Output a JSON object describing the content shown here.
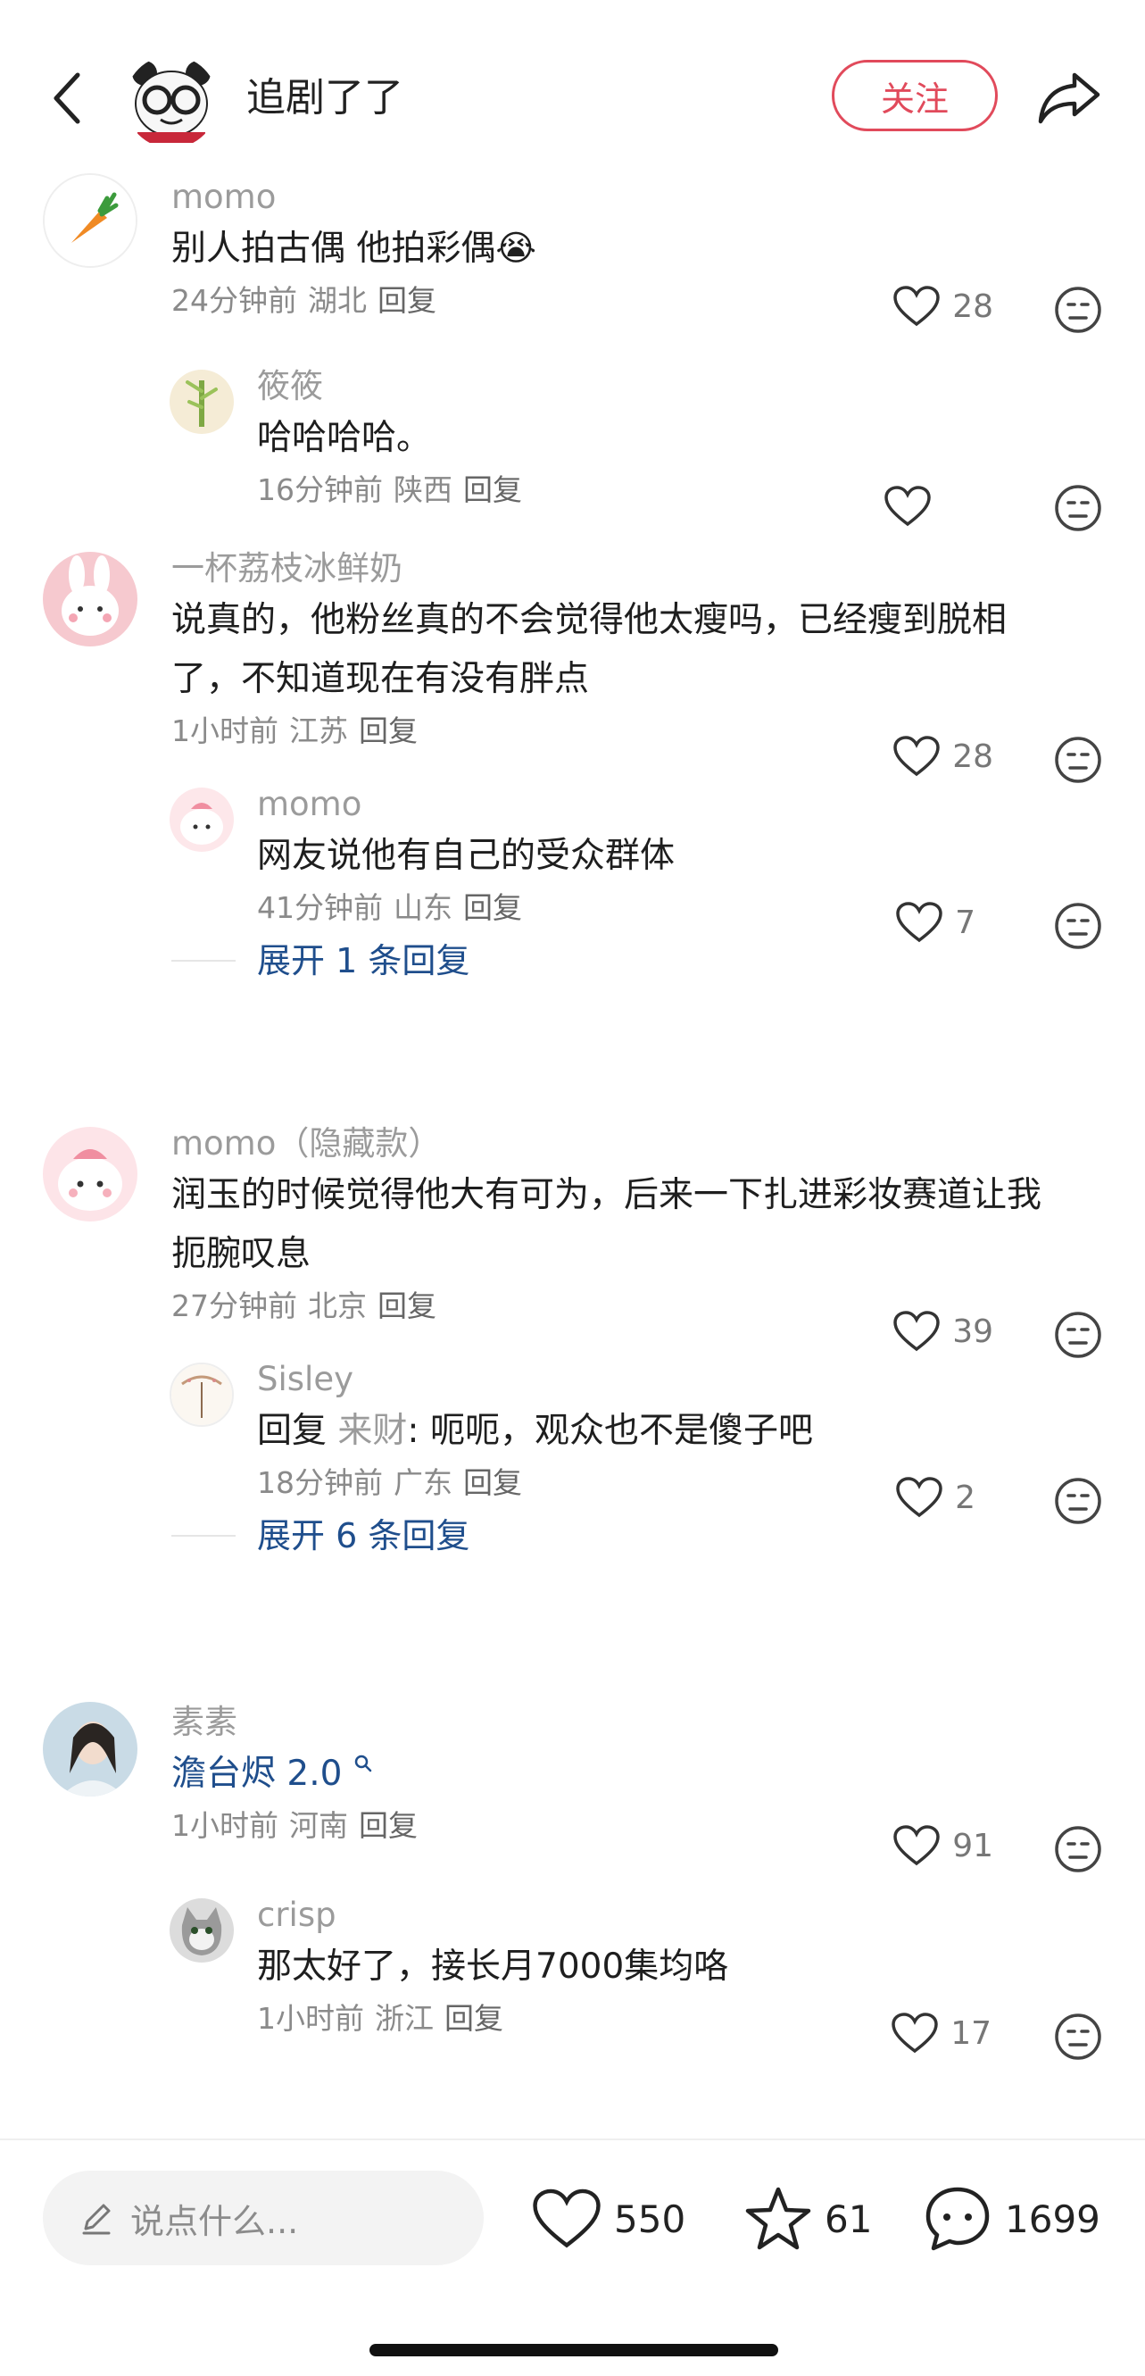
{
  "header": {
    "title": "追剧了了",
    "follow_label": "关注",
    "back_icon": "chevron-left-icon",
    "share_icon": "share-arrow-icon"
  },
  "comments": [
    {
      "username": "momo",
      "text": "别人拍古偶 他拍彩偶",
      "emoji": "😭",
      "time": "24分钟前",
      "location": "湖北",
      "reply_label": "回复",
      "likes": "28",
      "replies": [
        {
          "username": "筱筱",
          "text": "哈哈哈哈。",
          "time": "16分钟前",
          "location": "陕西",
          "reply_label": "回复",
          "likes": ""
        }
      ]
    },
    {
      "username": "一杯荔枝冰鲜奶",
      "text": "说真的，他粉丝真的不会觉得他太瘦吗，已经瘦到脱相了，不知道现在有没有胖点",
      "time": "1小时前",
      "location": "江苏",
      "reply_label": "回复",
      "likes": "28",
      "replies": [
        {
          "username": "momo",
          "text": "网友说他有自己的受众群体",
          "time": "41分钟前",
          "location": "山东",
          "reply_label": "回复",
          "likes": "7"
        }
      ],
      "expand_label": "展开 1 条回复"
    },
    {
      "username": "momo（隐藏款）",
      "text": "润玉的时候觉得他大有可为，后来一下扎进彩妆赛道让我扼腕叹息",
      "time": "27分钟前",
      "location": "北京",
      "reply_label": "回复",
      "likes": "39",
      "replies": [
        {
          "username": "Sisley",
          "reply_prefix": "回复 ",
          "quote_user": "来财",
          "text": ": 呃呃，观众也不是傻子吧",
          "time": "18分钟前",
          "location": "广东",
          "reply_label": "回复",
          "likes": "2"
        }
      ],
      "expand_label": "展开 6 条回复"
    },
    {
      "username": "素素",
      "text": "澹台烬 2.0",
      "time": "1小时前",
      "location": "河南",
      "reply_label": "回复",
      "likes": "91",
      "replies": [
        {
          "username": "crisp",
          "text": "那太好了，接长月7000集均咯",
          "time": "1小时前",
          "location": "浙江",
          "reply_label": "回复",
          "likes": "17"
        }
      ]
    }
  ],
  "bottom_bar": {
    "input_placeholder": "说点什么...",
    "likes": "550",
    "favorites": "61",
    "comments": "1699"
  },
  "colors": {
    "accent": "#e14a5b",
    "link": "#1f4e8c",
    "muted": "#9b9b9b"
  }
}
